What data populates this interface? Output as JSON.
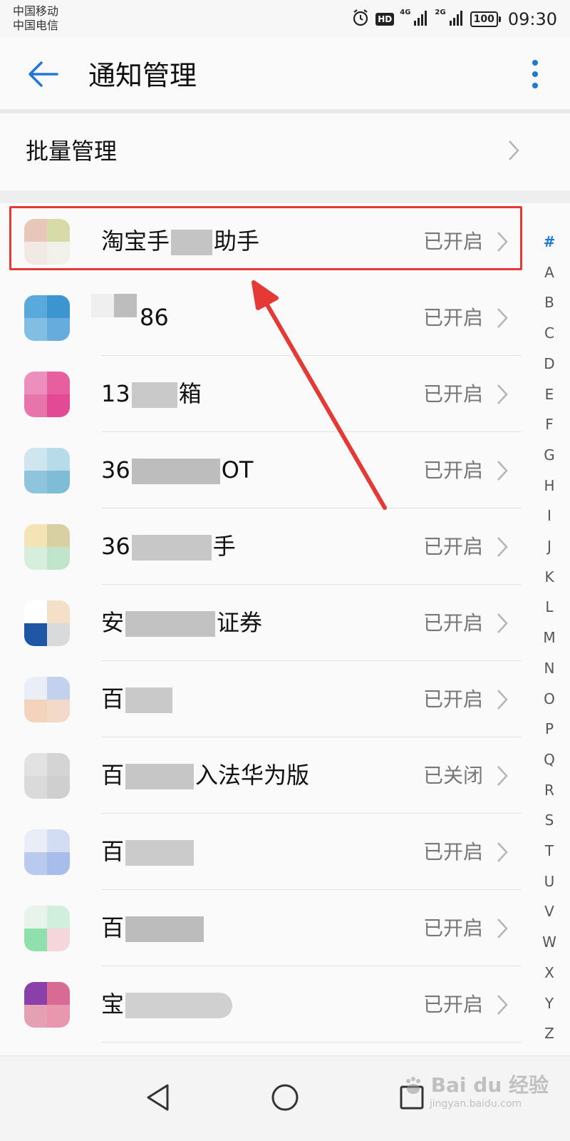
{
  "status_bar": {
    "carrier_1": "中国移动",
    "carrier_2": "中国电信",
    "hd": "HD",
    "net_1": "4G",
    "net_2": "2G",
    "battery": "100",
    "time": "09:30"
  },
  "header": {
    "title": "通知管理",
    "back_icon": "arrow-left-icon",
    "more_icon": "more-vertical-icon"
  },
  "batch": {
    "label": "批量管理"
  },
  "apps": [
    {
      "name": "淘宝手",
      "name_tail": "助手",
      "status": "已开启"
    },
    {
      "name": "",
      "name_tail": "86",
      "status": "已开启"
    },
    {
      "name": "13",
      "name_tail": "箱",
      "status": "已开启"
    },
    {
      "name": "36",
      "name_tail": "OT",
      "status": "已开启"
    },
    {
      "name": "36",
      "name_tail": "手",
      "status": "已开启"
    },
    {
      "name": "安",
      "name_tail": "证券",
      "status": "已开启"
    },
    {
      "name": "百",
      "name_tail": "",
      "status": "已开启"
    },
    {
      "name": "百",
      "name_tail": "入法华为版",
      "status": "已关闭"
    },
    {
      "name": "百",
      "name_tail": "",
      "status": "已开启"
    },
    {
      "name": "百",
      "name_tail": "",
      "status": "已开启"
    },
    {
      "name": "宝",
      "name_tail": "",
      "status": "已开启"
    }
  ],
  "alphabet_index": [
    "#",
    "A",
    "B",
    "C",
    "D",
    "E",
    "F",
    "G",
    "H",
    "I",
    "J",
    "K",
    "L",
    "M",
    "N",
    "O",
    "P",
    "Q",
    "R",
    "S",
    "T",
    "U",
    "V",
    "W",
    "X",
    "Y",
    "Z"
  ],
  "watermark": {
    "text": "Bai du 经验",
    "url": "jingyan.baidu.com"
  },
  "colors": {
    "accent": "#1e78d8",
    "highlight": "#e53935"
  }
}
